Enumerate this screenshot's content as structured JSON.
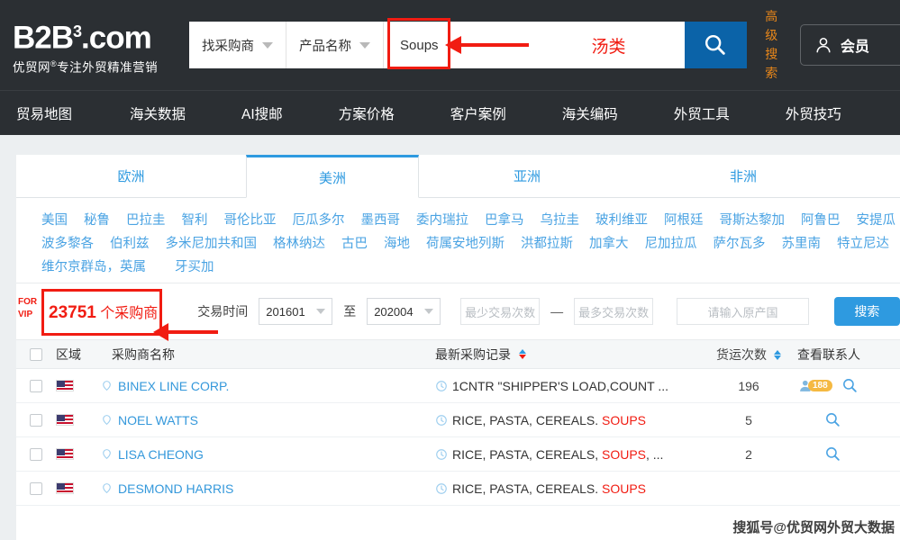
{
  "brand": {
    "name_main": "B2B",
    "name_sup": "3",
    "name_tld": ".com",
    "tagline_pre": "优贸网",
    "tagline_sup": "®",
    "tagline_post": "专注外贸精准营销"
  },
  "search": {
    "type_select": "找采购商",
    "field_select": "产品名称",
    "keyword": "Soups",
    "annotation": "汤类",
    "search_icon": "magnifier-icon",
    "advanced_line1": "高级",
    "advanced_line2": "搜索",
    "member_label": "会员",
    "member_icon": "user-icon",
    "highlight_color": "#f11c12",
    "button_color": "#0b63a8"
  },
  "nav": {
    "items": [
      "贸易地图",
      "海关数据",
      "AI搜邮",
      "方案价格",
      "客户案例",
      "海关编码",
      "外贸工具",
      "外贸技巧"
    ]
  },
  "region_tabs": {
    "active": "美洲",
    "items": [
      "欧洲",
      "美洲",
      "亚洲",
      "非洲"
    ],
    "accent": "#2e9ae0"
  },
  "countries": {
    "row1": [
      "美国",
      "秘鲁",
      "巴拉圭",
      "智利",
      "哥伦比亚",
      "厄瓜多尔",
      "墨西哥",
      "委内瑞拉",
      "巴拿马",
      "乌拉圭",
      "玻利维亚",
      "阿根廷",
      "哥斯达黎加",
      "阿鲁巴",
      "安提瓜"
    ],
    "row2": [
      "波多黎各",
      "伯利兹",
      "多米尼加共和国",
      "格林纳达",
      "古巴",
      "海地",
      "荷属安地列斯",
      "洪都拉斯",
      "加拿大",
      "尼加拉瓜",
      "萨尔瓦多",
      "苏里南",
      "特立尼达"
    ],
    "row3": [
      "维尔京群岛，英属",
      "牙买加"
    ]
  },
  "filters": {
    "vip_tag_line1": "FOR",
    "vip_tag_line2": "VIP",
    "count_number": "23751",
    "count_suffix": " 个采购商",
    "time_label": "交易时间",
    "time_from": "201601",
    "time_to": "202004",
    "time_between": "至",
    "min_trades_placeholder": "最少交易次数",
    "max_trades_placeholder": "最多交易次数",
    "range_dash": "—",
    "origin_placeholder": "请输入原产国",
    "search_button": "搜索"
  },
  "table": {
    "headers": {
      "region": "区域",
      "buyer": "采购商名称",
      "record": "最新采购记录",
      "shipments": "货运次数",
      "contact": "查看联系人"
    },
    "rows": [
      {
        "flag": "us-flag-icon",
        "buyer": "BINEX LINE CORP.",
        "record_plain": "1CNTR \"SHIPPER'S LOAD,COUNT ...",
        "record_highlight": "",
        "record_tail": "",
        "shipments": "196",
        "contact_badge": "188",
        "has_contacts": true
      },
      {
        "flag": "us-flag-icon",
        "buyer": "NOEL WATTS",
        "record_plain": "RICE, PASTA, CEREALS. ",
        "record_highlight": "SOUPS",
        "record_tail": "",
        "shipments": "5",
        "contact_badge": "",
        "has_contacts": false
      },
      {
        "flag": "us-flag-icon",
        "buyer": "LISA CHEONG",
        "record_plain": "RICE, PASTA, CEREALS, ",
        "record_highlight": "SOUPS",
        "record_tail": ", ...",
        "shipments": "2",
        "contact_badge": "",
        "has_contacts": false
      },
      {
        "flag": "us-flag-icon",
        "buyer": "DESMOND HARRIS",
        "record_plain": "RICE, PASTA, CEREALS. ",
        "record_highlight": "SOUPS",
        "record_tail": "",
        "shipments": "",
        "contact_badge": "",
        "has_contacts": false
      }
    ]
  },
  "watermark": "搜狐号@优贸网外贸大数据"
}
